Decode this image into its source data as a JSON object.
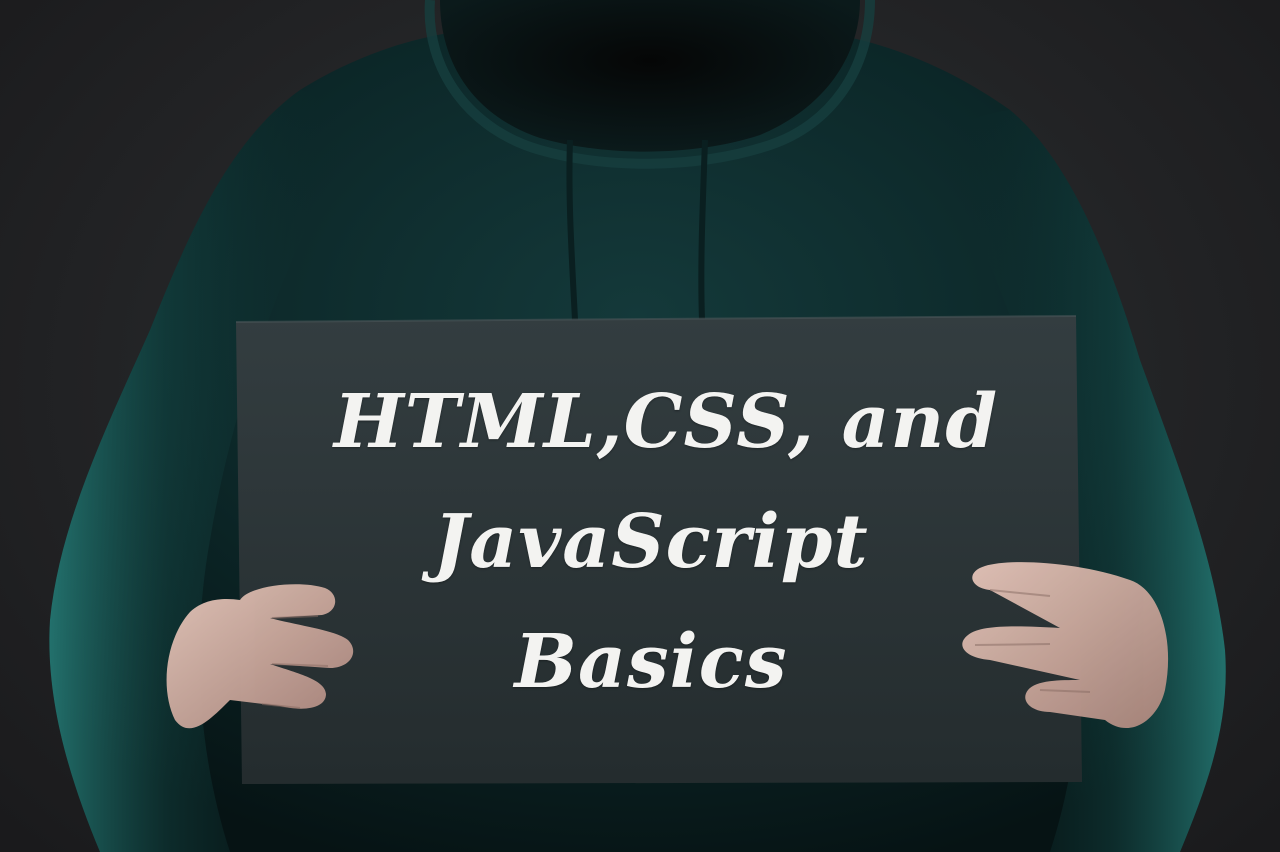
{
  "photo": {
    "sign": {
      "line1": "HTML,CSS, and",
      "line2": "JavaScript",
      "line3": "Basics"
    }
  },
  "colors": {
    "background": "#232426",
    "hoodie": "#0e2a2b",
    "hoodie_highlight": "#1f6a66",
    "sign_board": "#2a3336",
    "sign_text": "#f3f3f1",
    "skin": "#c9a79c"
  }
}
